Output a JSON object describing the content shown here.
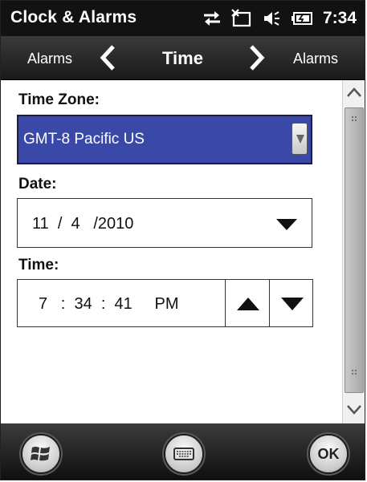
{
  "status_bar": {
    "app_title": "Clock & Alarms",
    "time": "7:34",
    "icons": [
      "sync-arrows-icon",
      "no-signal-icon",
      "volume-icon",
      "battery-icon"
    ]
  },
  "nav": {
    "prev_label": "Alarms",
    "title": "Time",
    "next_label": "Alarms"
  },
  "form": {
    "timezone_label": "Time Zone:",
    "timezone_value": "GMT-8 Pacific US",
    "date_label": "Date:",
    "date_value": "11  /  4   /2010",
    "time_label": "Time:",
    "time_value": "7   :  34  :  41     PM"
  },
  "softkeys": {
    "ok_label": "OK"
  },
  "colors": {
    "selection_bg": "#3a48a8",
    "status_bar_bg": "#121212",
    "nav_bar_bg": "#2a2a2a"
  }
}
